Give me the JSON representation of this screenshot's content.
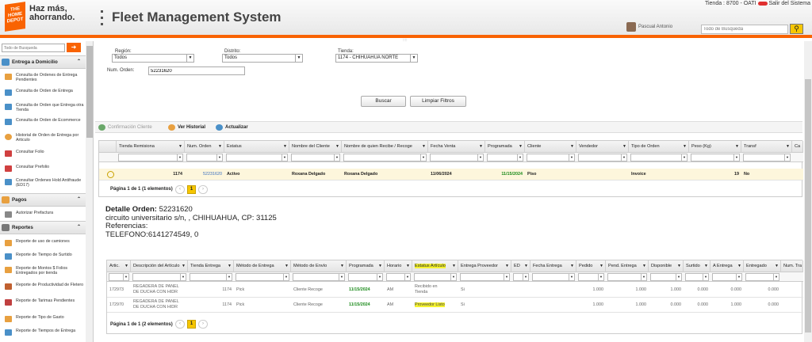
{
  "header": {
    "logo_text": "THE HOME DEPOT",
    "slogan": "Haz más, ahorrando.",
    "app_title": "Fleet Management System",
    "store_info": "Tienda : 8700 - OATI",
    "logout": "Salir del Sistema",
    "user_name": "Pascual Antonio",
    "search_placeholder": "Todo de Busqueda",
    "search_icon": "search-icon"
  },
  "sidebar": {
    "search_placeholder": "Todo de Busqueda",
    "sections": [
      {
        "label": "Entrega a Domicilio",
        "items": [
          "Consulta de Ordenes de Entrega Pendientes",
          "Consulta de Orden de Entrega",
          "Consulta de Orden que Entrega otra Tienda",
          "Consulta de Orden de Ecommerce",
          "Historial de Orden de Entrega por Articulo",
          "Consultar Folio",
          "Consultar Prefolio",
          "Consultar Ordenes Hold Antifraude (ED17)"
        ]
      },
      {
        "label": "Pagos",
        "items": [
          "Autorizar Prefactura"
        ]
      },
      {
        "label": "Reportes",
        "items": [
          "Reporte de uso de camiones",
          "Reporte de Tiempo de Surtido",
          "Reporte de Montos $ Folios Entregados por tienda",
          "Reporte de Productividad de Fletero",
          "Reporte de Tarimas Pendientes",
          "Reporte de Tipo de Gasto",
          "Reporte de Tiempos de Entrega"
        ]
      }
    ]
  },
  "filters": {
    "region_label": "Región:",
    "region_value": "Todos",
    "distrito_label": "Distrito:",
    "distrito_value": "Todos",
    "tienda_label": "Tienda:",
    "tienda_value": "1174 - CHIHUAHUA NORTE",
    "orden_label": "Num. Orden:",
    "orden_value": "52231620",
    "buscar": "Buscar",
    "limpiar": "Limpiar Filtros"
  },
  "toolbar": {
    "confirmacion": "Confirmación Cliente",
    "historial": "Ver Historial",
    "actualizar": "Actualizar"
  },
  "grid1": {
    "columns": [
      "Tienda Remisiona",
      "Num. Orden",
      "Estatus",
      "Nombre del Cliente",
      "Nombre de quien Recibe / Recoge",
      "Fecha Venta",
      "Programada",
      "Cliente",
      "Vendedor",
      "Tipo de Orden",
      "Peso (Kg)",
      "Transf",
      "Ca"
    ],
    "row": {
      "tienda": "1174",
      "orden": "52231620",
      "estatus": "Activo",
      "cliente": "Roxana Delgado",
      "recibe": "Roxana Delgado",
      "fecha": "11/06/2024",
      "programada": "11/15/2024",
      "cliente_tipo": "Piso",
      "vendedor": "",
      "tipo": "Invoice",
      "peso": "19",
      "transf": "No"
    },
    "pager": "Página 1 de 1 (1 elementos)",
    "page": "1"
  },
  "detail": {
    "title_label": "Detalle Orden:",
    "order": "52231620",
    "address": "circuito universitario s/n, , CHIHUAHUA, CP: 31125",
    "referencias": "Referencias:",
    "telefono": "TELEFONO:6141274549, 0"
  },
  "grid2": {
    "columns": [
      "Artic.",
      "Descripción del Artículo",
      "Tienda Entrega",
      "Método de Entrega",
      "Método de Envío",
      "Programada",
      "Horario",
      "Estatus Artículo",
      "Entrega Proveedor",
      "ED",
      "Fecha Entrega",
      "Pedido",
      "Pend. Entrega",
      "Disponible",
      "Surtido",
      "A Entrega",
      "Entregado",
      "Num. Tra"
    ],
    "rows": [
      {
        "art": "172973",
        "desc1": "REGADERA DE PANEL",
        "desc2": "DE DUCHA CON HIDR",
        "tienda": "1174",
        "metodo": "Pick",
        "envio": "Cliente Recoge",
        "programada": "11/15/2024",
        "horario": "AM",
        "estatus1": "Recibido en",
        "estatus2": "Tienda",
        "proveedor": "Si",
        "pedido": "1.000",
        "pend": "1.000",
        "disp": "1.000",
        "surtido": "0.000",
        "aentrega": "0.000",
        "entregado": "0.000"
      },
      {
        "art": "172970",
        "desc1": "REGADERA DE PANEL",
        "desc2": "DE DUCHA CON HIDR",
        "tienda": "1174",
        "metodo": "Pick",
        "envio": "Cliente Recoge",
        "programada": "11/15/2024",
        "horario": "AM",
        "estatus1": "Proveedor Listo",
        "estatus2": "",
        "proveedor": "Si",
        "pedido": "1.000",
        "pend": "1.000",
        "disp": "0.000",
        "surtido": "0.000",
        "aentrega": "1.000",
        "entregado": "0.000"
      }
    ],
    "pager": "Página 1 de 1 (2 elementos)",
    "page": "1"
  },
  "colors": {
    "brand": "#f96302",
    "highlight": "#f4f230",
    "accent": "#f6c600"
  }
}
